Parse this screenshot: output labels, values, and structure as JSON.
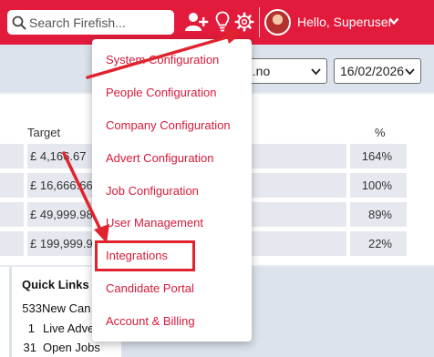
{
  "header": {
    "search_placeholder": "Search Firefish...",
    "greeting": "Hello, Superuser",
    "brand_color": "#e21b3c"
  },
  "filters": {
    "selected_option": "...no",
    "date": "16/02/2026"
  },
  "table": {
    "target_header": "Target",
    "percent_header": "%",
    "rows": [
      {
        "target": "£ 4,166.67",
        "percent": "164%"
      },
      {
        "target": "£ 16,666.66",
        "percent": "100%"
      },
      {
        "target": "£ 49,999.98",
        "percent": "89%"
      },
      {
        "target": "£ 199,999.92",
        "percent": "22%"
      }
    ]
  },
  "quick_links": {
    "title": "Quick Links",
    "items": [
      {
        "count": "533",
        "label": "New Can"
      },
      {
        "count": "1",
        "label": "Live Adve"
      },
      {
        "count": "31",
        "label": "Open Jobs"
      }
    ]
  },
  "settings_menu": {
    "items": [
      "System Configuration",
      "People Configuration",
      "Company Configuration",
      "Advert Configuration",
      "Job Configuration",
      "User Management",
      "Integrations",
      "Candidate Portal",
      "Account & Billing"
    ],
    "highlighted": "Integrations",
    "text_color": "#d51a3a",
    "annotation_color": "#e0232f"
  },
  "icons": {
    "search": "search-icon",
    "add_user": "add-user-icon",
    "idea": "lightbulb-icon",
    "settings": "gear-icon",
    "dropdown": "chevron-down-icon"
  }
}
